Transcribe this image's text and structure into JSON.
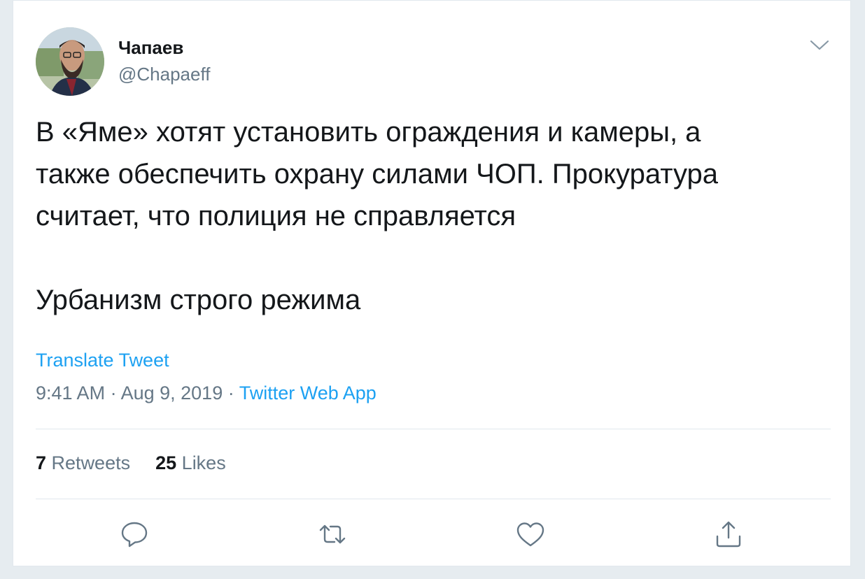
{
  "tweet": {
    "display_name": "Чапаев",
    "handle": "@Chapaeff",
    "text_lines": [
      "В «Яме» хотят установить ограждения и камеры, а",
      "также обеспечить охрану силами ЧОП. Прокуратура",
      "считает, что полиция не справляется"
    ],
    "text_second_paragraph": "Урбанизм строго режима",
    "translate_label": "Translate Tweet",
    "time": "9:41 AM",
    "separator": " · ",
    "date": "Aug 9, 2019",
    "source": "Twitter Web App"
  },
  "stats": {
    "retweets_count": "7",
    "retweets_label": "Retweets",
    "likes_count": "25",
    "likes_label": "Likes"
  },
  "icons": {
    "more": "chevron-down-icon",
    "reply": "reply-icon",
    "retweet": "retweet-icon",
    "like": "heart-icon",
    "share": "share-icon"
  },
  "colors": {
    "link": "#1da1f2",
    "secondary": "#657786",
    "primary": "#14171a",
    "icon": "#657786"
  }
}
